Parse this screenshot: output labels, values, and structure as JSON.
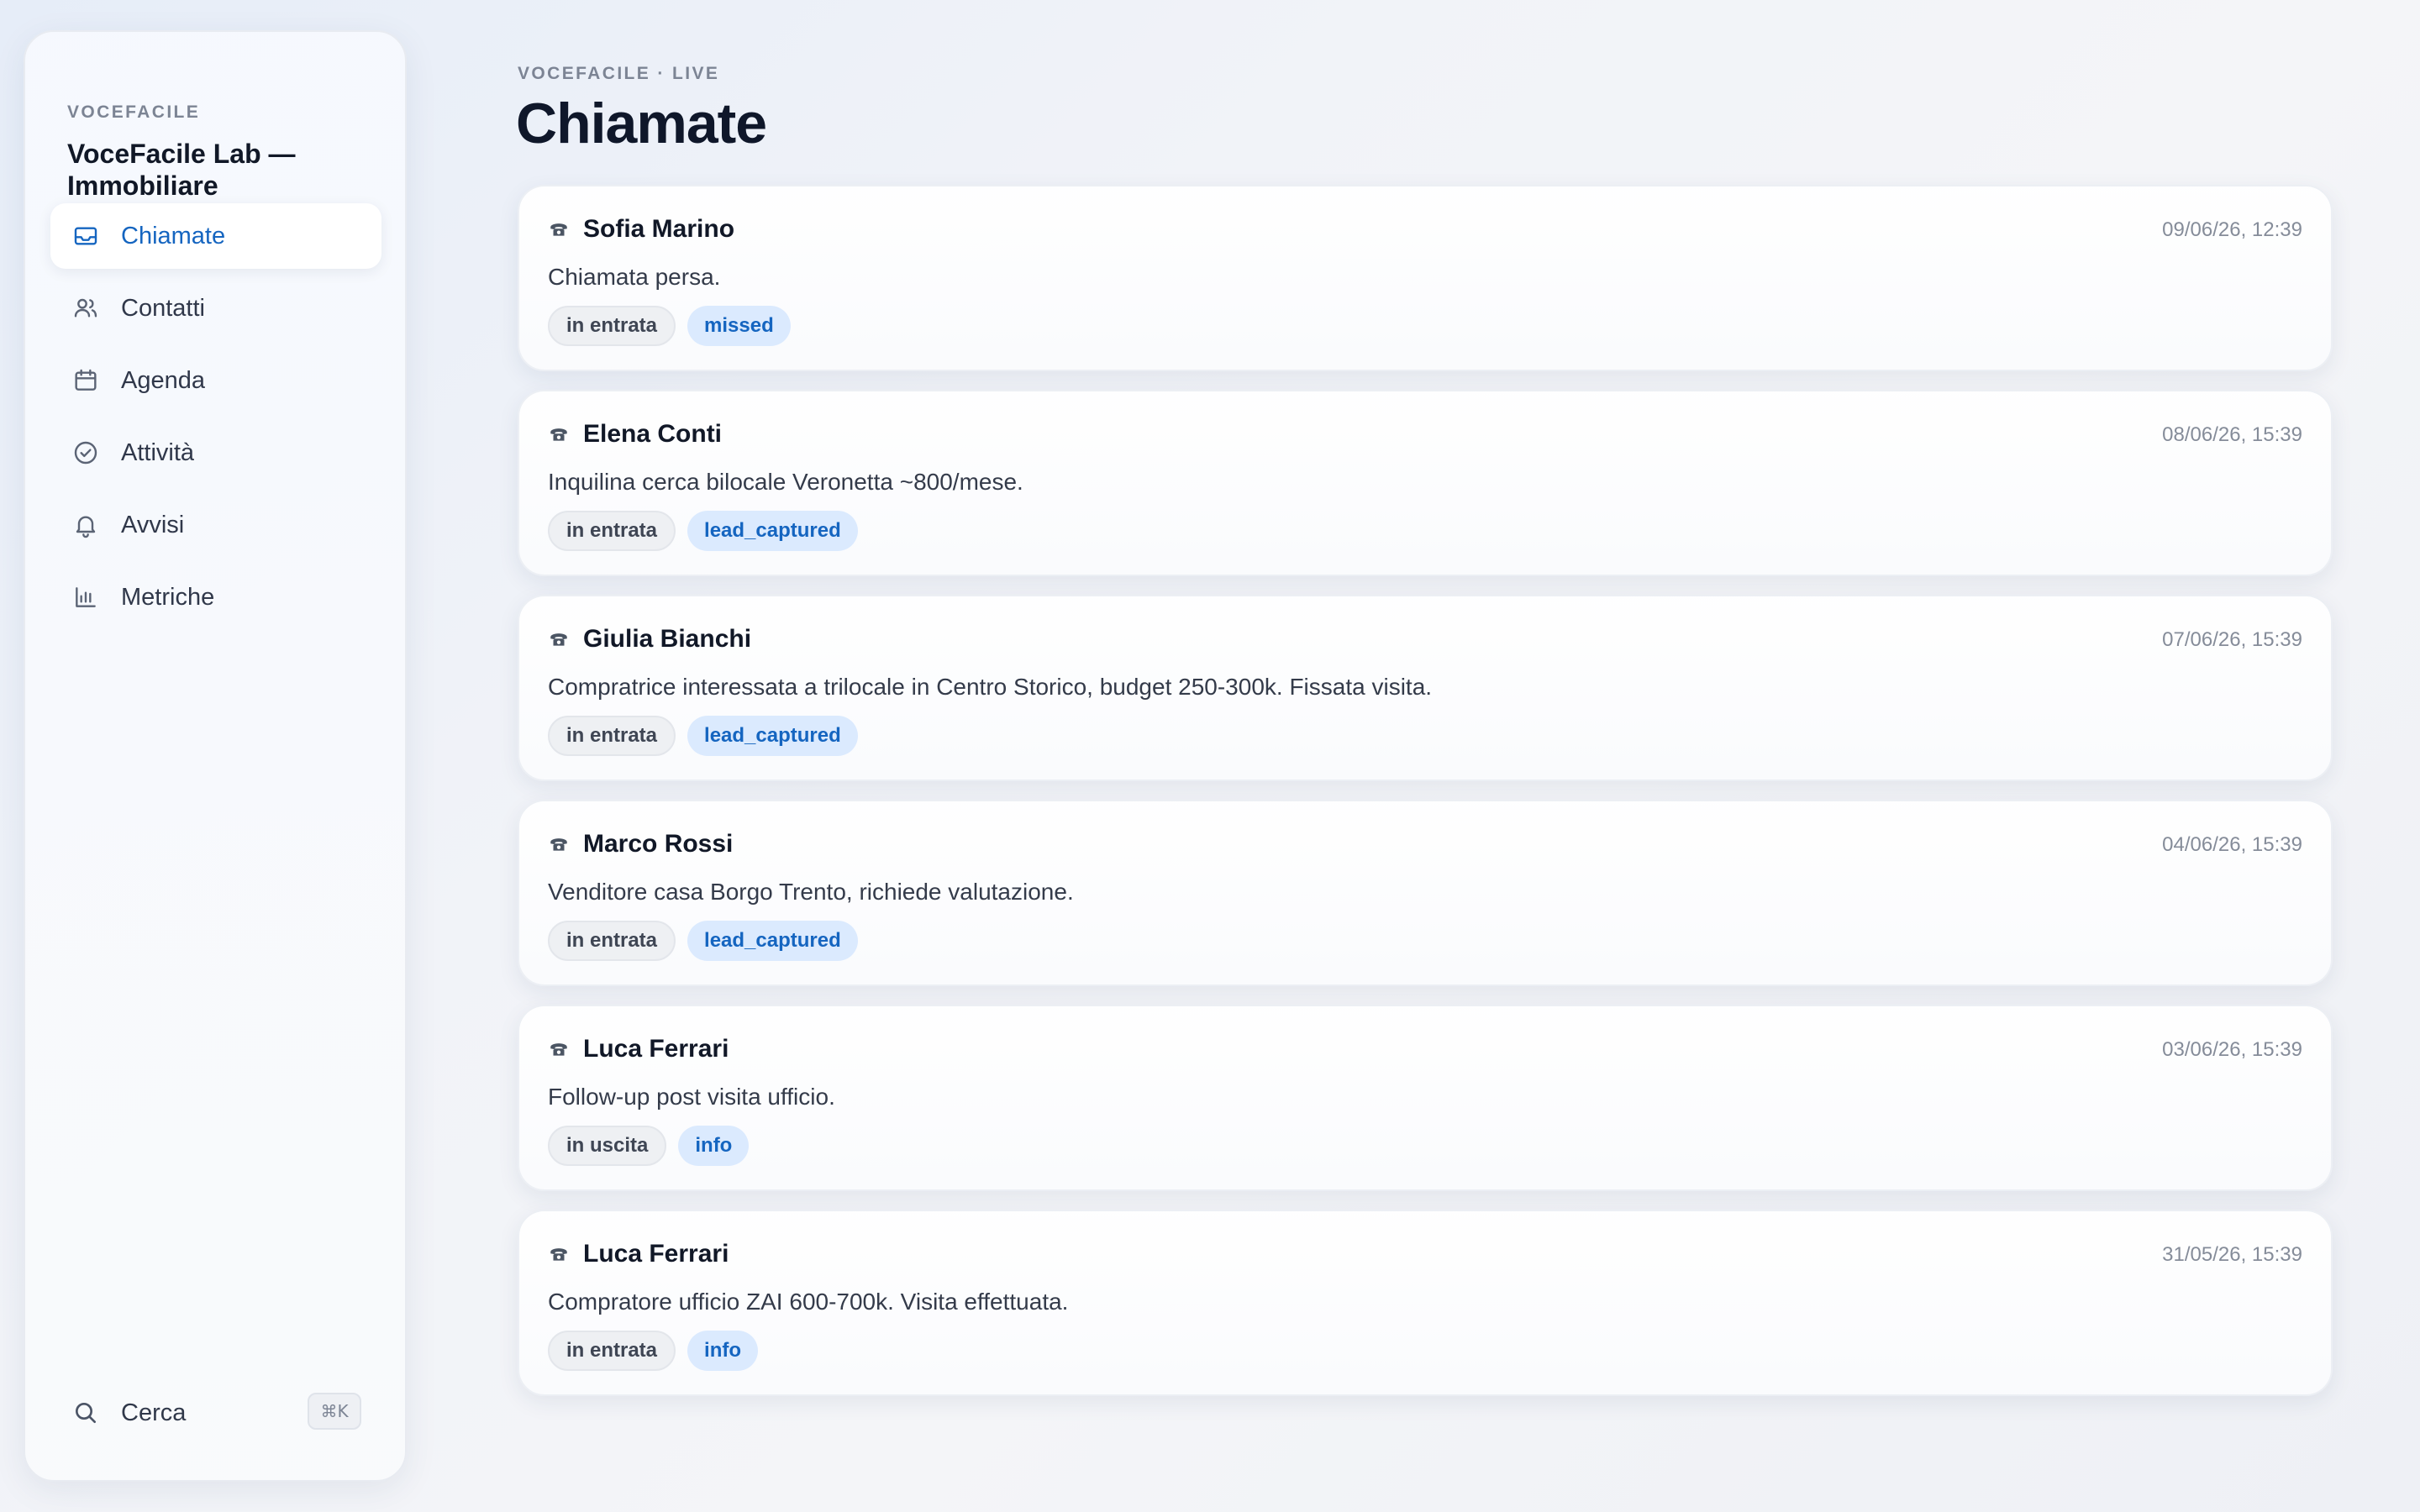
{
  "sidebar": {
    "brand": "VOCEFACILE",
    "workspace": "VoceFacile Lab — Immobiliare",
    "items": [
      {
        "label": "Chiamate",
        "icon": "inbox-icon",
        "active": true
      },
      {
        "label": "Contatti",
        "icon": "users-icon",
        "active": false
      },
      {
        "label": "Agenda",
        "icon": "calendar-icon",
        "active": false
      },
      {
        "label": "Attività",
        "icon": "check-circle-icon",
        "active": false
      },
      {
        "label": "Avvisi",
        "icon": "bell-icon",
        "active": false
      },
      {
        "label": "Metriche",
        "icon": "bar-chart-icon",
        "active": false
      }
    ],
    "search": {
      "label": "Cerca",
      "shortcut": "⌘K",
      "icon": "search-icon"
    }
  },
  "header": {
    "eyebrow": "VOCEFACILE · LIVE",
    "title": "Chiamate"
  },
  "calls": [
    {
      "name": "Sofia Marino",
      "time": "09/06/26, 12:39",
      "summary": "Chiamata persa.",
      "direction": "in entrata",
      "status": "missed"
    },
    {
      "name": "Elena Conti",
      "time": "08/06/26, 15:39",
      "summary": "Inquilina cerca bilocale Veronetta ~800/mese.",
      "direction": "in entrata",
      "status": "lead_captured"
    },
    {
      "name": "Giulia Bianchi",
      "time": "07/06/26, 15:39",
      "summary": "Compratrice interessata a trilocale in Centro Storico, budget 250-300k. Fissata visita.",
      "direction": "in entrata",
      "status": "lead_captured"
    },
    {
      "name": "Marco Rossi",
      "time": "04/06/26, 15:39",
      "summary": "Venditore casa Borgo Trento, richiede valutazione.",
      "direction": "in entrata",
      "status": "lead_captured"
    },
    {
      "name": "Luca Ferrari",
      "time": "03/06/26, 15:39",
      "summary": "Follow-up post visita ufficio.",
      "direction": "in uscita",
      "status": "info"
    },
    {
      "name": "Luca Ferrari",
      "time": "31/05/26, 15:39",
      "summary": "Compratore ufficio ZAI 600-700k. Visita effettuata.",
      "direction": "in entrata",
      "status": "info"
    }
  ],
  "colors": {
    "accent": "#1565c0",
    "tag_status_bg": "#dbeafe",
    "tag_direction_bg": "#eef0f3"
  }
}
